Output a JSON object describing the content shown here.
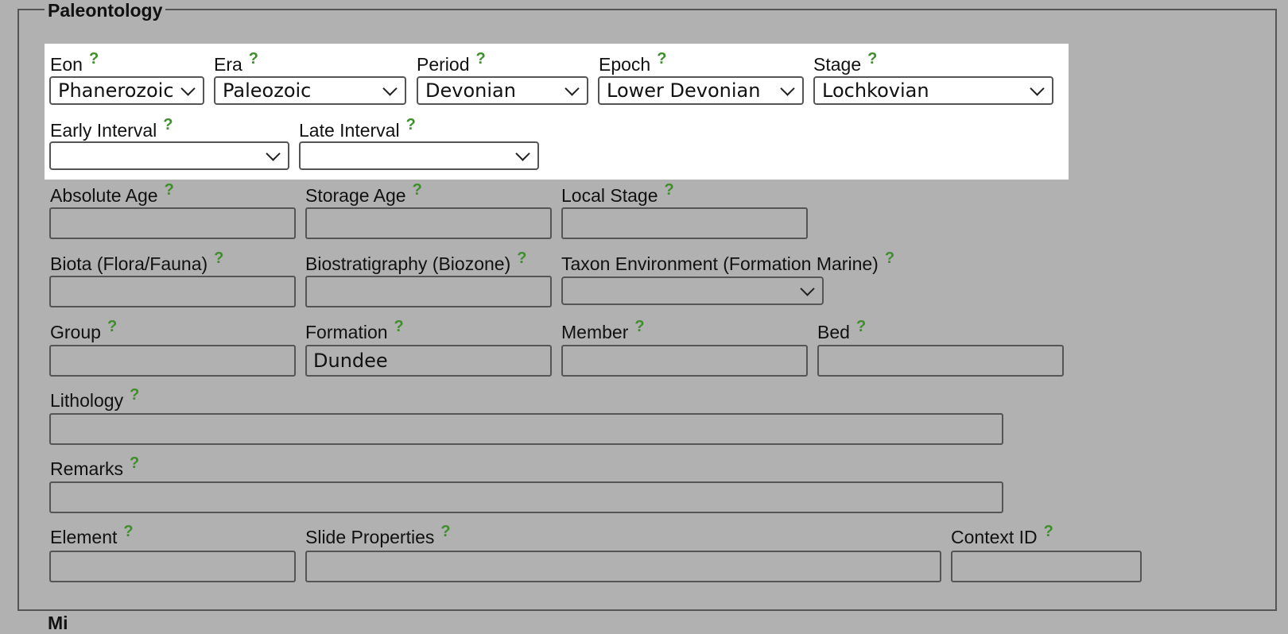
{
  "section": {
    "title": "Paleontology",
    "next_title": "Mi"
  },
  "help_symbol": "?",
  "colors": {
    "help": "#3e8e2b",
    "background": "#b1b1b1"
  },
  "icons": {
    "help": "question-mark-icon",
    "dropdown": "chevron-down-icon"
  },
  "chrono": {
    "eon": {
      "label": "Eon",
      "value": "Phanerozoic"
    },
    "era": {
      "label": "Era",
      "value": "Paleozoic"
    },
    "period": {
      "label": "Period",
      "value": "Devonian"
    },
    "epoch": {
      "label": "Epoch",
      "value": "Lower Devonian"
    },
    "stage": {
      "label": "Stage",
      "value": "Lochkovian"
    },
    "early_interval": {
      "label": "Early Interval",
      "value": ""
    },
    "late_interval": {
      "label": "Late Interval",
      "value": ""
    }
  },
  "fields": {
    "absolute_age": {
      "label": "Absolute Age",
      "value": ""
    },
    "storage_age": {
      "label": "Storage Age",
      "value": ""
    },
    "local_stage": {
      "label": "Local Stage",
      "value": ""
    },
    "biota": {
      "label": "Biota (Flora/Fauna)",
      "value": ""
    },
    "biostratigraphy": {
      "label": "Biostratigraphy (Biozone)",
      "value": ""
    },
    "taxon_environment": {
      "label": "Taxon Environment (Formation Marine)",
      "value": ""
    },
    "group": {
      "label": "Group",
      "value": ""
    },
    "formation": {
      "label": "Formation",
      "value": "Dundee"
    },
    "member": {
      "label": "Member",
      "value": ""
    },
    "bed": {
      "label": "Bed",
      "value": ""
    },
    "lithology": {
      "label": "Lithology",
      "value": ""
    },
    "remarks": {
      "label": "Remarks",
      "value": ""
    },
    "element": {
      "label": "Element",
      "value": ""
    },
    "slide_properties": {
      "label": "Slide Properties",
      "value": ""
    },
    "context_id": {
      "label": "Context ID",
      "value": ""
    }
  }
}
